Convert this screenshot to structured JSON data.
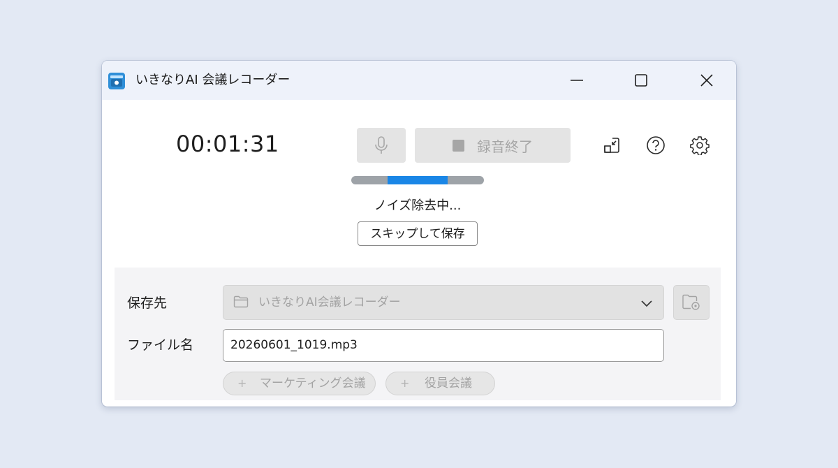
{
  "window": {
    "title": "いきなりAI 会議レコーダー",
    "controls": {
      "minimize": "minimize-icon",
      "maximize": "maximize-icon",
      "close": "close-icon"
    }
  },
  "recorder": {
    "elapsed": "00:01:31",
    "mic_icon": "microphone-icon",
    "stop_label": "録音終了",
    "tools": [
      "minimize-to-corner-icon",
      "help-icon",
      "gear-icon"
    ]
  },
  "processing": {
    "progress_fraction": 0.45,
    "status": "ノイズ除去中...",
    "skip_label": "スキップして保存"
  },
  "save_panel": {
    "destination_label": "保存先",
    "destination_value": "いきなりAI会議レコーダー",
    "filename_label": "ファイル名",
    "filename_value": "20260601_1019.mp3",
    "tags": [
      "マーケティング会議",
      "役員会議"
    ]
  },
  "colors": {
    "accent": "#1a86e6",
    "track": "#9ea3a8",
    "disabled_bg": "#e4e4e4",
    "disabled_text": "#a6a6a6",
    "titlebar": "#eef2fa",
    "page_bg": "#e3e9f4"
  }
}
